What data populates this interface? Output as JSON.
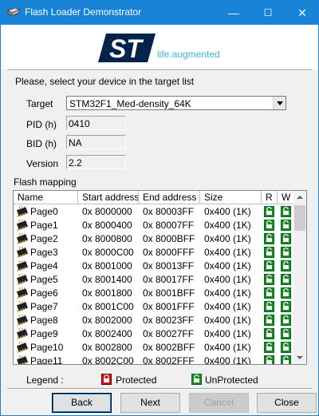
{
  "window": {
    "title": "Flash Loader Demonstrator",
    "minimize": "—",
    "maximize": "☐",
    "close": "✕"
  },
  "logo": {
    "brand": "ST",
    "tagline": "life.augmented",
    "brand_color": "#03234b",
    "tagline_color": "#3cb4e6"
  },
  "instruction": "Please, select your device in the target list",
  "target": {
    "label": "Target",
    "value": "STM32F1_Med-density_64K"
  },
  "pid": {
    "label": "PID  (h)",
    "value": "0410"
  },
  "bid": {
    "label": "BID  (h)",
    "value": "NA"
  },
  "version": {
    "label": "Version",
    "value": "2.2"
  },
  "flash_mapping": {
    "label": "Flash mapping",
    "columns": [
      "Name",
      "Start address",
      "End address",
      "Size",
      "R",
      "W"
    ],
    "rows": [
      {
        "name": "Page0",
        "start": "0x 8000000",
        "end": "0x 80003FF",
        "size": "0x400 (1K)"
      },
      {
        "name": "Page1",
        "start": "0x 8000400",
        "end": "0x 80007FF",
        "size": "0x400 (1K)"
      },
      {
        "name": "Page2",
        "start": "0x 8000800",
        "end": "0x 8000BFF",
        "size": "0x400 (1K)"
      },
      {
        "name": "Page3",
        "start": "0x 8000C00",
        "end": "0x 8000FFF",
        "size": "0x400 (1K)"
      },
      {
        "name": "Page4",
        "start": "0x 8001000",
        "end": "0x 80013FF",
        "size": "0x400 (1K)"
      },
      {
        "name": "Page5",
        "start": "0x 8001400",
        "end": "0x 80017FF",
        "size": "0x400 (1K)"
      },
      {
        "name": "Page6",
        "start": "0x 8001800",
        "end": "0x 8001BFF",
        "size": "0x400 (1K)"
      },
      {
        "name": "Page7",
        "start": "0x 8001C00",
        "end": "0x 8001FFF",
        "size": "0x400 (1K)"
      },
      {
        "name": "Page8",
        "start": "0x 8002000",
        "end": "0x 80023FF",
        "size": "0x400 (1K)"
      },
      {
        "name": "Page9",
        "start": "0x 8002400",
        "end": "0x 80027FF",
        "size": "0x400 (1K)"
      },
      {
        "name": "Page10",
        "start": "0x 8002800",
        "end": "0x 8002BFF",
        "size": "0x400 (1K)"
      },
      {
        "name": "Page11",
        "start": "0x 8002C00",
        "end": "0x 8002FFF",
        "size": "0x400 (1K)"
      }
    ]
  },
  "legend": {
    "label": "Legend :",
    "protected": "Protected",
    "unprotected": "UnProtected",
    "protected_color": "#d01010",
    "unprotected_color": "#1a8a1a"
  },
  "buttons": {
    "back": "Back",
    "next": "Next",
    "cancel": "Cancel",
    "close": "Close"
  }
}
